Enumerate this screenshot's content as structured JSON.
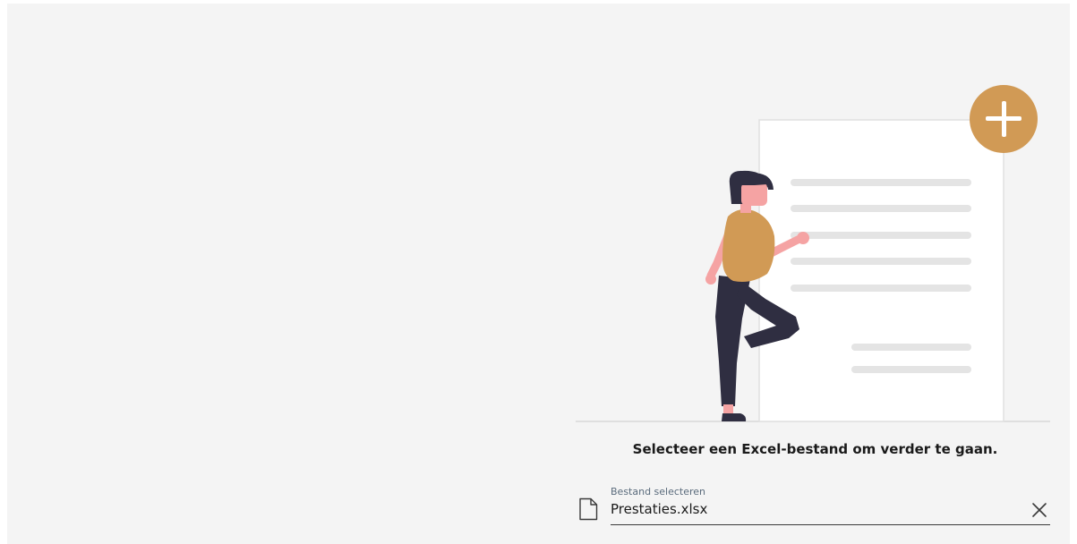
{
  "upload": {
    "prompt": "Selecteer een Excel-bestand om verder te gaan.",
    "field_label": "Bestand selecteren",
    "field_value": "Prestaties.xlsx",
    "file_icon": "file-icon",
    "clear_icon": "close-icon"
  },
  "colors": {
    "accent": "#d19a55",
    "panel_background": "#f4f4f4",
    "figure_dark": "#2f2e41",
    "skin": "#f5a3a3"
  }
}
